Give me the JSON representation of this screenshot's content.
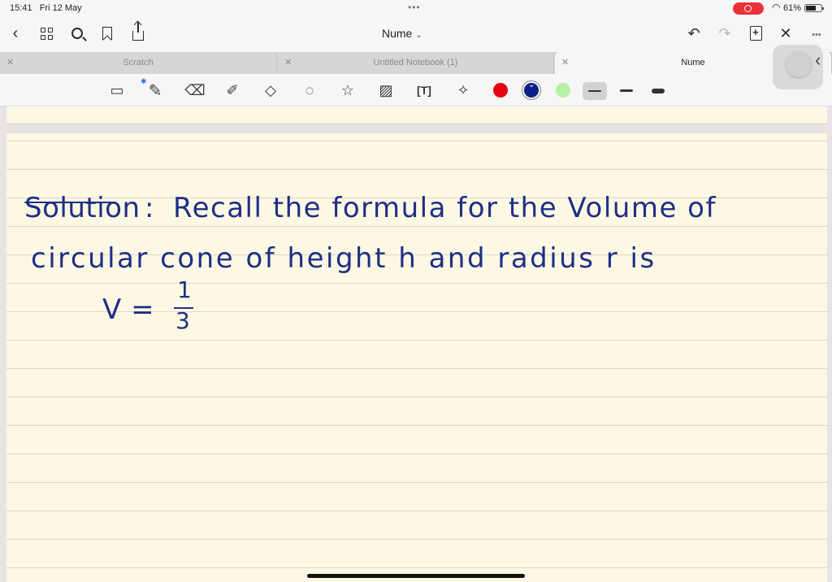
{
  "status_bar": {
    "time": "15:41",
    "date": "Fri 12 May",
    "battery": "61%"
  },
  "nav": {
    "title": "Nume"
  },
  "tabs": [
    {
      "label": "Scratch"
    },
    {
      "label": "Untitled Notebook (1)"
    },
    {
      "label": "Nume"
    }
  ],
  "toolbar": {
    "colors": [
      "#e60012",
      "#0d1f87",
      "#b6f2a6"
    ],
    "selected_color": "#0d1f87"
  },
  "note": {
    "line1": {
      "solution": "Solution",
      "colon": ":",
      "text": "Recall the formula for the Volume of"
    },
    "line2": "circular cone of height h and radius r is",
    "formula": {
      "lhs": "V =",
      "numerator": "1",
      "denominator": "3"
    }
  },
  "icons": {
    "back": "chevron-left-icon",
    "thumbnails": "grid-icon",
    "search": "search-icon",
    "bookmark": "bookmark-icon",
    "share": "share-icon",
    "undo": "undo-icon",
    "redo": "redo-icon",
    "add_page": "add-page-icon",
    "close": "close-icon",
    "more": "more-icon"
  }
}
